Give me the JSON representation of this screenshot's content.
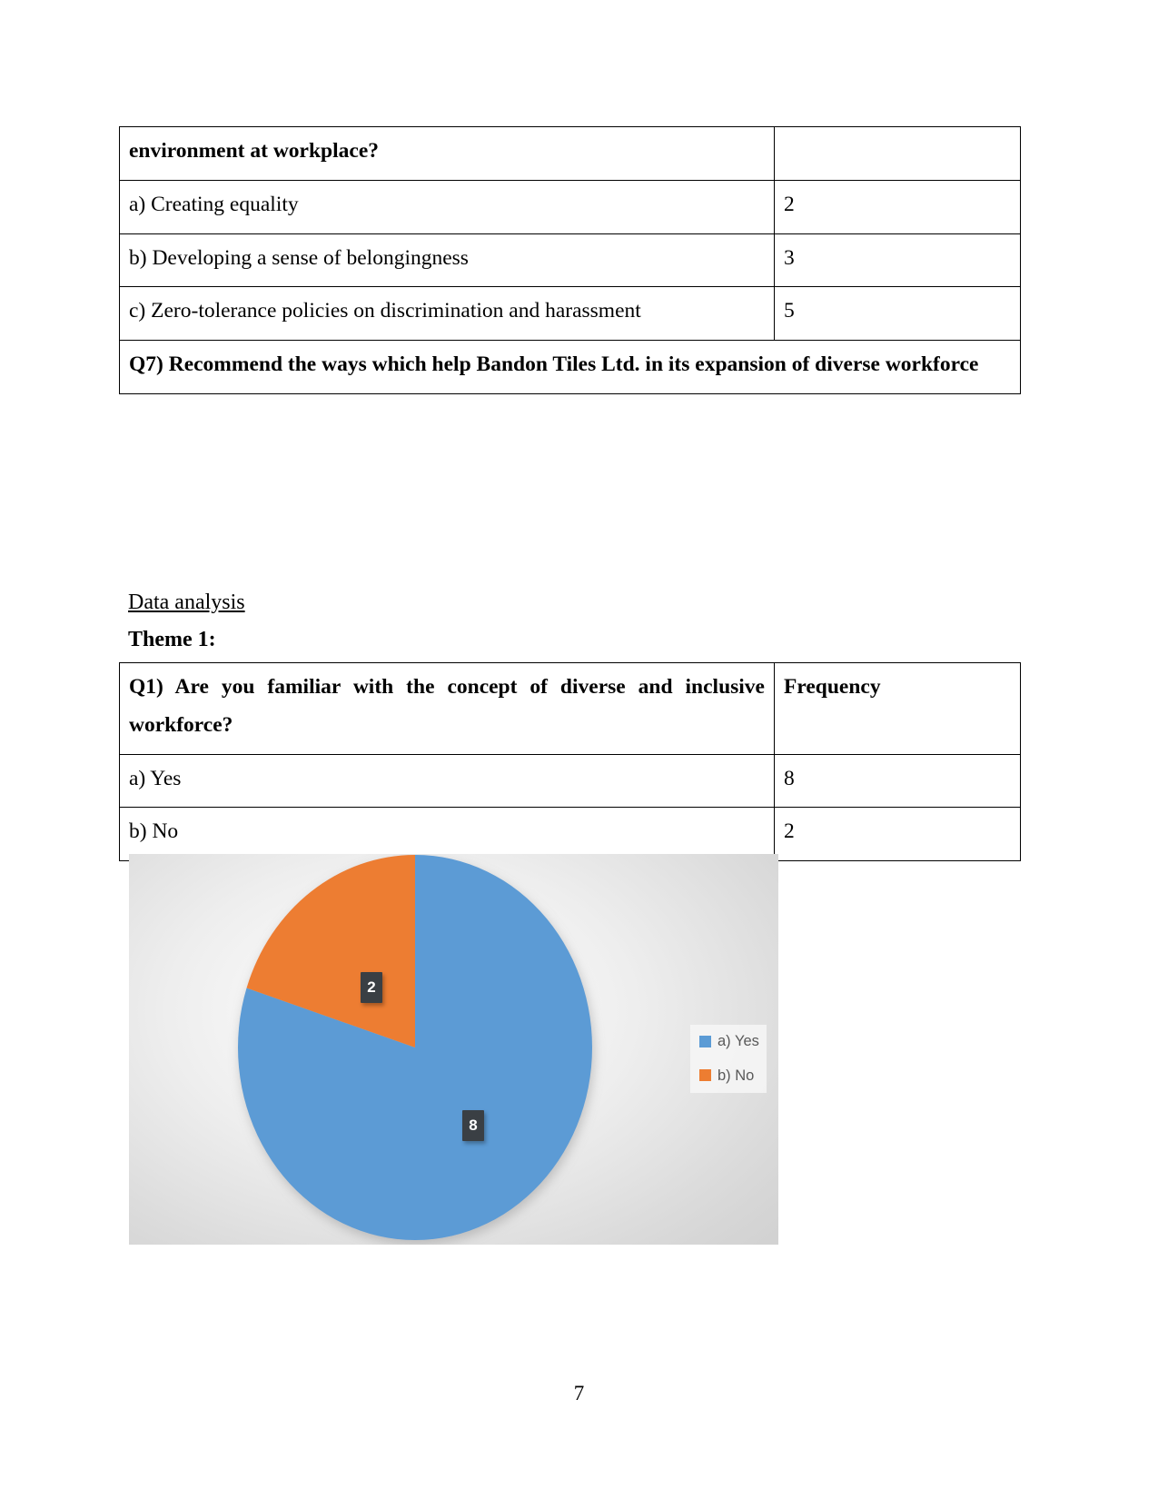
{
  "tables": {
    "top": {
      "rows": [
        {
          "label": "environment at workplace?",
          "value": "",
          "bold": true
        },
        {
          "label": "a) Creating equality",
          "value": "2",
          "bold": false
        },
        {
          "label": "b) Developing a sense of belongingness",
          "value": "3",
          "bold": false
        },
        {
          "label": "c) Zero-tolerance policies on discrimination and harassment",
          "value": "5",
          "bold": false
        }
      ],
      "spanning_row": "Q7) Recommend the ways which help Bandon Tiles Ltd. in its expansion of diverse workforce"
    },
    "theme1": {
      "header": {
        "question": "Q1) Are you familiar with the concept of diverse and inclusive workforce?",
        "frequency": "Frequency"
      },
      "rows": [
        {
          "label": "a) Yes",
          "value": "8"
        },
        {
          "label": "b) No",
          "value": "2"
        }
      ]
    }
  },
  "headings": {
    "data_analysis": "Data analysis",
    "theme": "Theme 1:"
  },
  "chart_data": {
    "type": "pie",
    "title": "",
    "categories": [
      "a) Yes",
      "b) No"
    ],
    "values": [
      8,
      2
    ],
    "labels": [
      "8",
      "2"
    ],
    "colors": [
      "#5B9BD5",
      "#ED7D31"
    ],
    "legend_position": "right",
    "start_angle": 0,
    "total": 10
  },
  "footer": {
    "page_number": "7"
  }
}
